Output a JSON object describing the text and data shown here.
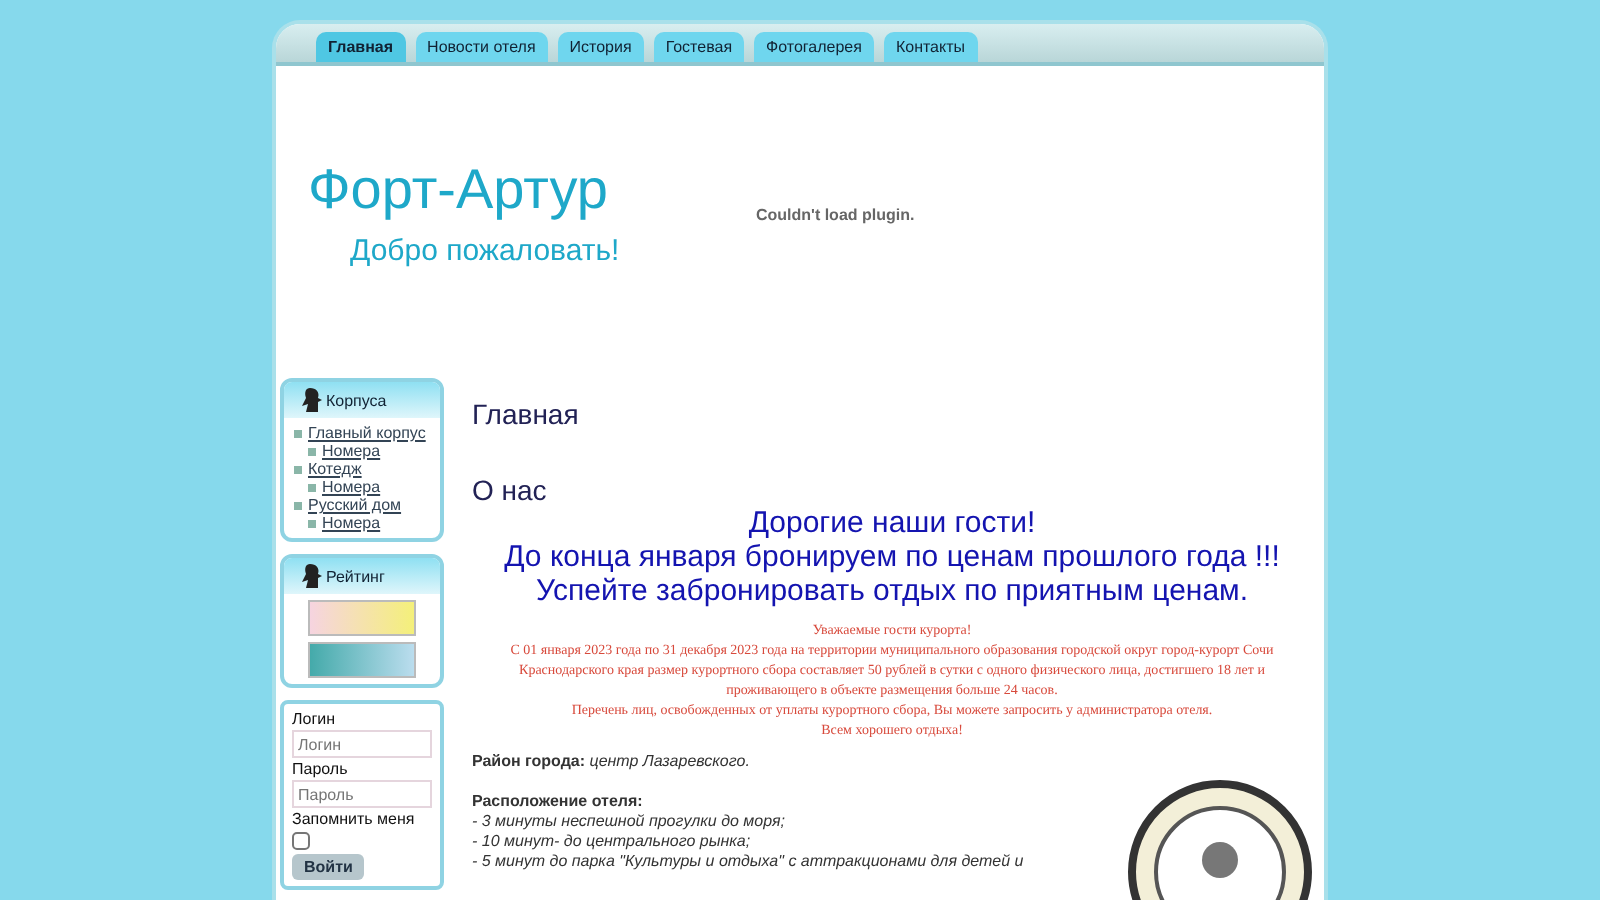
{
  "tabs": [
    {
      "label": "Главная",
      "selected": true
    },
    {
      "label": "Новости отеля",
      "selected": false
    },
    {
      "label": "История",
      "selected": false
    },
    {
      "label": "Гостевая",
      "selected": false
    },
    {
      "label": "Фотогалерея",
      "selected": false
    },
    {
      "label": "Контакты",
      "selected": false
    }
  ],
  "header": {
    "title": "Форт-Артур",
    "subtitle": "Добро пожаловать!",
    "plugin_message": "Couldn't load plugin."
  },
  "sidebar": {
    "buildings": {
      "title": "Корпуса",
      "items": [
        {
          "label": "Главный корпус",
          "children": [
            {
              "label": "Номера"
            }
          ]
        },
        {
          "label": "Котедж",
          "children": [
            {
              "label": "Номера"
            }
          ]
        },
        {
          "label": "Русский дом",
          "children": [
            {
              "label": "Номера"
            }
          ]
        }
      ]
    },
    "rating": {
      "title": "Рейтинг"
    },
    "login": {
      "login_label": "Логин",
      "login_placeholder": "Логин",
      "password_label": "Пароль",
      "password_placeholder": "Пароль",
      "remember_label": "Запомнить меня",
      "remember_checked": false,
      "submit": "Войти"
    }
  },
  "content": {
    "page_title": "Главная",
    "section_title": "О нас",
    "greeting": [
      "Дорогие наши гости!",
      "До конца января бронируем по ценам прошлого года !!!",
      "Успейте забронировать отдых по приятным ценам."
    ],
    "notice": [
      "Уважаемые гости курорта!",
      "С 01 января 2023 года по 31 декабря 2023 года на территории  муниципального образования городской округ город-курорт Сочи Краснодарского края размер  курортного сбора составляет 50 рублей в сутки с одного физического лица, достигшего 18 лет и проживающего в объекте размещения больше 24 часов.",
      "Перечень лиц, освобожденных от уплаты курортного сбора, Вы можете запросить у администратора отеля.",
      "Всем хорошего отдыха!"
    ],
    "district_label": "Район города:",
    "district_value": "центр Лазаревского.",
    "location_title": "Расположение отеля:",
    "location_items": [
      "- 3 минуты неспешной прогулки до моря;",
      "- 10 минут- до центрального рынка;",
      "- 5 минут до парка \"Культуры и отдыха\" с аттракционами для детей и"
    ]
  }
}
